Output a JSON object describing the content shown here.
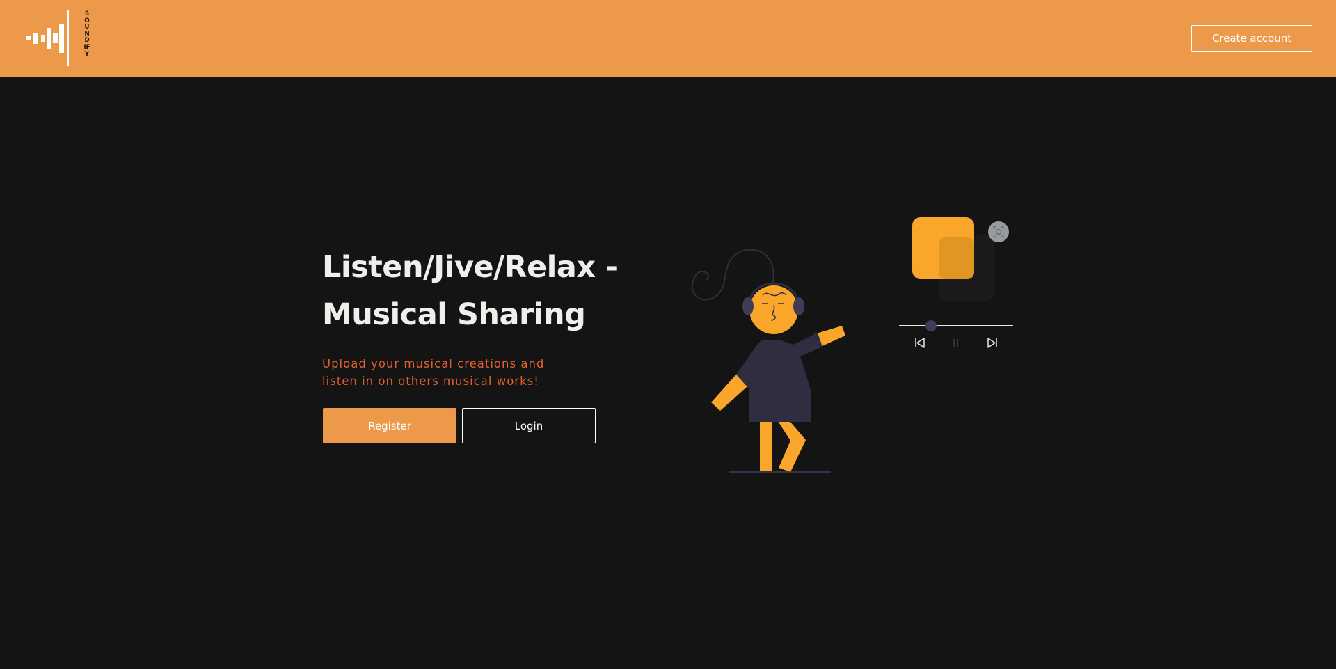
{
  "header": {
    "logo_text": "SOUNDIFY",
    "create_account_label": "Create account"
  },
  "hero": {
    "title": "Listen/Jive/Relax - Musical Sharing",
    "subtitle": "Upload your musical creations and listen in on others musical works!",
    "register_label": "Register",
    "login_label": "Login"
  },
  "player": {
    "progress": 0.28
  },
  "colors": {
    "brand_orange": "#ec9a4a",
    "background": "#141414",
    "subtitle_orange": "#e0612e",
    "cover_yellow": "#f9a62a",
    "figure_dark": "#2f2e41"
  },
  "icons": {
    "logo": "soundwave-bars-icon",
    "prev": "skip-previous-icon",
    "pause": "pause-icon",
    "next": "skip-next-icon",
    "cover_action": "image-focus-icon"
  }
}
